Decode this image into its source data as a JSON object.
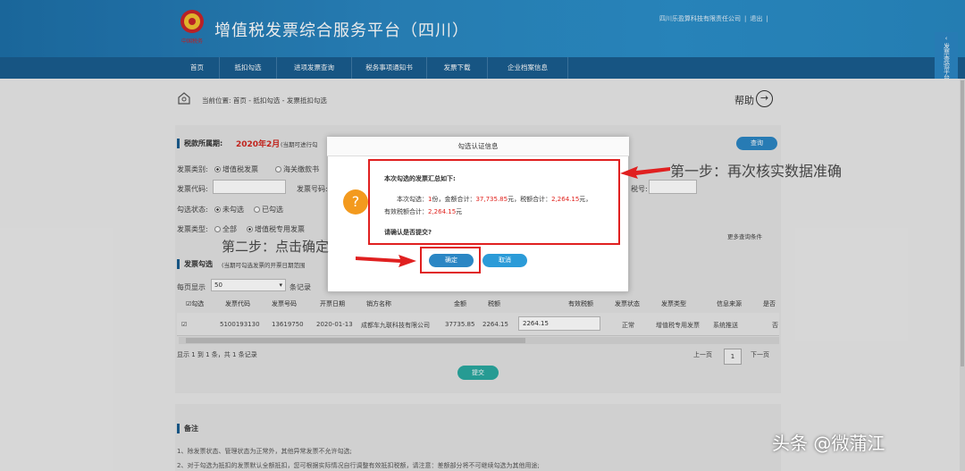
{
  "header": {
    "title": "增值税发票综合服务平台（四川）",
    "company": "四川乐盈算科技有限责任公司",
    "sep1": "|",
    "logout": "退出",
    "sep2": "|"
  },
  "nav": {
    "items": [
      "首页",
      "抵扣勾选",
      "进项发票查询",
      "税务事项通知书",
      "发票下载",
      "企业档案信息"
    ]
  },
  "side_tab": "发票查验平台",
  "breadcrumb": {
    "prefix": "当前位置:",
    "path": "首页 - 抵扣勾选 - 发票抵扣勾选",
    "help": "帮助"
  },
  "tax_period": {
    "label": "税款所属期:",
    "value": "2020年2月",
    "note": "(当期可进行勾"
  },
  "filters": {
    "invoice_category_label": "发票类别:",
    "option_vat": "增值税发票",
    "option_customs": "海关缴款书",
    "invoice_code_label": "发票代码:",
    "invoice_no_label": "发票号码:",
    "tax_no_label": "税号:",
    "status_label": "勾选状态:",
    "status_unchecked": "未勾选",
    "status_checked": "已勾选",
    "type_label": "发票类型:",
    "type_all": "全部",
    "type_special": "增值税专用发票",
    "more": "更多查询条件",
    "query_button": "查询"
  },
  "section": {
    "title": "发票勾选",
    "note": "(当期可勾选发票的开票日期范围"
  },
  "page_size": {
    "prefix": "每页显示",
    "value": "50",
    "suffix": "条记录"
  },
  "table": {
    "headers": [
      "勾选",
      "发票代码",
      "发票号码",
      "开票日期",
      "销方名称",
      "金额",
      "税额",
      "有效税额",
      "发票状态",
      "发票类型",
      "信息来源",
      "是否"
    ],
    "row": [
      "5100193130",
      "13619750",
      "2020-01-13",
      "成都车九联科技有限公司",
      "37735.85",
      "2264.15",
      "2264.15",
      "正常",
      "增值税专用发票",
      "系统推送",
      "否"
    ]
  },
  "pagination": {
    "summary": "显示 1 到 1 条，共 1 条记录",
    "prev": "上一页",
    "current": "1",
    "next": "下一页"
  },
  "submit_button": "提交",
  "notes": {
    "title": "备注",
    "line1": "1、除发票状态、管理状态为正常外，其他异常发票不允许勾选;",
    "line2": "2、对于勾选为抵扣的发票默认全额抵扣，您可根据实际情况自行调整有效抵扣税额，请注意：差额部分将不可继续勾选为其他用途;"
  },
  "dialog": {
    "title": "勾选认证信息",
    "heading": "本次勾选的发票汇总如下:",
    "line1_a": "本次勾选：",
    "count": "1",
    "line1_b": "份，金额合计：",
    "amount": "37,735.85",
    "line1_c": "元，税额合计：",
    "tax": "2,264.15",
    "line1_d": "元，",
    "line2_a": "有效税额合计：",
    "valid_tax": "2,264.15",
    "line2_b": "元",
    "confirm_question": "请确认是否提交?",
    "ok": "确定",
    "cancel": "取消"
  },
  "annotations": {
    "step1": "第一步：再次核实数据准确",
    "step2": "第二步：点击确定"
  },
  "watermark": "头条 @微蒲江",
  "colors": {
    "header": "#2a86c0",
    "nav": "#1a5d8f",
    "highlight": "#e02020",
    "warning": "#f39a1e",
    "tax_period": "#d2261f"
  }
}
